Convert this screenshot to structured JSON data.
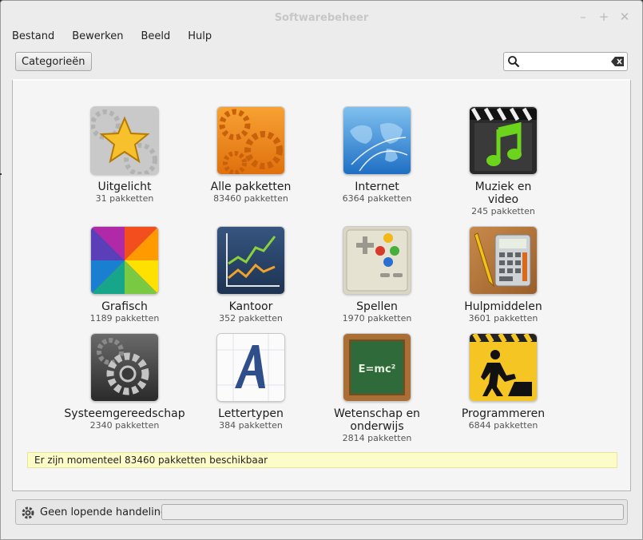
{
  "window": {
    "title": "Softwarebeheer"
  },
  "menu": [
    "Bestand",
    "Bewerken",
    "Beeld",
    "Hulp"
  ],
  "toolbar": {
    "categories_label": "Categorieën",
    "search_placeholder": ""
  },
  "categories": [
    {
      "name": "Uitgelicht",
      "count": "31 pakketten",
      "icon": "star-icon"
    },
    {
      "name": "Alle pakketten",
      "count": "83460 pakketten",
      "icon": "gears-icon"
    },
    {
      "name": "Internet",
      "count": "6364 pakketten",
      "icon": "globe-icon"
    },
    {
      "name": "Muziek en video",
      "name_line1": "Muziek en",
      "name_line2": "video",
      "count": "245 pakketten",
      "icon": "music-icon"
    },
    {
      "name": "Grafisch",
      "count": "1189 pakketten",
      "icon": "color-wheel-icon"
    },
    {
      "name": "Kantoor",
      "count": "352 pakketten",
      "icon": "chart-icon"
    },
    {
      "name": "Spellen",
      "count": "1970 pakketten",
      "icon": "gamepad-icon"
    },
    {
      "name": "Hulpmiddelen",
      "count": "3601 pakketten",
      "icon": "calculator-icon"
    },
    {
      "name": "Systeemgereedschap",
      "count": "2340 pakketten",
      "icon": "system-gear-icon"
    },
    {
      "name": "Lettertypen",
      "count": "384 pakketten",
      "icon": "font-icon"
    },
    {
      "name": "Wetenschap en onderwijs",
      "name_line1": "Wetenschap en",
      "name_line2": "onderwijs",
      "count": "2814 pakketten",
      "icon": "chalkboard-icon",
      "board_text": "E=mc²"
    },
    {
      "name": "Programmeren",
      "count": "6844 pakketten",
      "icon": "construction-icon"
    }
  ],
  "info": "Er zijn momenteel 83460 pakketten beschikbaar",
  "status": {
    "text": "Geen lopende handelingen"
  },
  "colors": {
    "info_bg": "#fcfcc8",
    "window_bg": "#ececec",
    "content_bg": "#f5f5f5"
  }
}
